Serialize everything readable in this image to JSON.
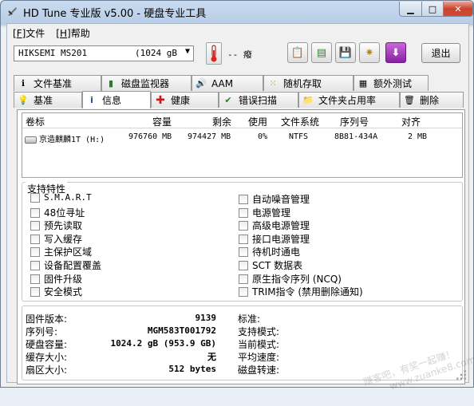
{
  "window": {
    "title": "HD Tune 专业版 v5.00 - 硬盘专业工具"
  },
  "menu": [
    {
      "key": "F",
      "label": "文件"
    },
    {
      "key": "H",
      "label": "帮助"
    }
  ],
  "toolbar": {
    "drive_name": "HIKSEMI MS201",
    "drive_capacity": "(1024 gB",
    "temperature": "-- 癈",
    "exit_label": "退出",
    "icons": [
      "copy-icon",
      "copy-green-icon",
      "save-icon",
      "settings-icon",
      "download-icon"
    ]
  },
  "tabs_top": [
    {
      "label": "文件基准",
      "icon": "info-icon"
    },
    {
      "label": "磁盘监视器",
      "icon": "bar-chart-icon"
    },
    {
      "label": "AAM",
      "icon": "speaker-icon"
    },
    {
      "label": "随机存取",
      "icon": "random-access-icon"
    },
    {
      "label": "额外测试",
      "icon": "extra-tests-icon"
    }
  ],
  "tabs_bottom": [
    {
      "label": "基准",
      "icon": "benchmark-icon"
    },
    {
      "label": "信息",
      "icon": "info-icon"
    },
    {
      "label": "健康",
      "icon": "health-cross-icon"
    },
    {
      "label": "错误扫描",
      "icon": "error-scan-icon"
    },
    {
      "label": "文件夹占用率",
      "icon": "folder-icon"
    },
    {
      "label": "删除",
      "icon": "trash-icon"
    }
  ],
  "active_tab": "信息",
  "table": {
    "headers": [
      "卷标",
      "容量",
      "剩余",
      "使用",
      "文件系统",
      "序列号",
      "对齐"
    ],
    "rows": [
      [
        "京造麒麟1T (H:)",
        "976760 MB",
        "974427 MB",
        "0%",
        "NTFS",
        "8B81-434A",
        "2 MB"
      ]
    ]
  },
  "features": {
    "title": "支持特性",
    "left": [
      "S.M.A.R.T",
      "48位寻址",
      "预先读取",
      "写入缓存",
      "主保护区域",
      "设备配置覆盖",
      "固件升级",
      "安全模式"
    ],
    "right": [
      "自动噪音管理",
      "电源管理",
      "高级电源管理",
      "接口电源管理",
      "待机时通电",
      "SCT 数据表",
      "原生指令序列 (NCQ)",
      "TRIM指令 (禁用删除通知)"
    ]
  },
  "info": {
    "firmware_label": "固件版本:",
    "firmware": "9139",
    "serial_label": "序列号:",
    "serial": "MGM583T001792",
    "capacity_label": "硬盘容量:",
    "capacity": "1024.2 gB (953.9 GB)",
    "buffer_label": "缓存大小:",
    "buffer": "无",
    "sector_label": "扇区大小:",
    "sector": "512 bytes",
    "standard_label": "标准:",
    "support_mode_label": "支持模式:",
    "current_mode_label": "当前模式:",
    "avg_speed_label": "平均速度:",
    "rotation_label": "磁盘转速:"
  },
  "watermark": {
    "line1": "赚客吧，有奖一起赚！",
    "line2": "www.zuanke8.com"
  }
}
